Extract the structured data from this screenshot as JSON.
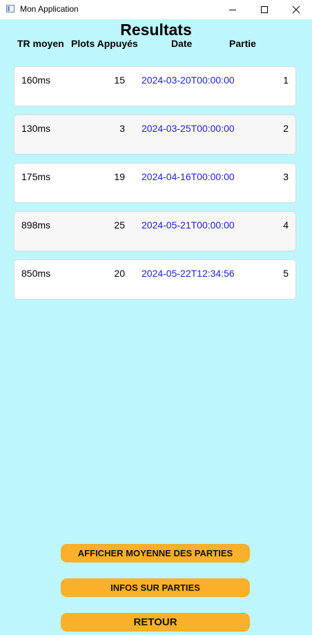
{
  "window": {
    "title": "Mon Application"
  },
  "page": {
    "title": "Resultats"
  },
  "columns": {
    "tr": "TR moyen",
    "plots": "Plots Appuyés",
    "date": "Date",
    "partie": "Partie"
  },
  "rows": [
    {
      "tr": "160ms",
      "plots": "15",
      "date": "2024-03-20T00:00:00",
      "partie": "1"
    },
    {
      "tr": "130ms",
      "plots": "3",
      "date": "2024-03-25T00:00:00",
      "partie": "2"
    },
    {
      "tr": "175ms",
      "plots": "19",
      "date": "2024-04-16T00:00:00",
      "partie": "3"
    },
    {
      "tr": "898ms",
      "plots": "25",
      "date": "2024-05-21T00:00:00",
      "partie": "4"
    },
    {
      "tr": "850ms",
      "plots": "20",
      "date": "2024-05-22T12:34:56",
      "partie": "5"
    }
  ],
  "buttons": {
    "average": "AFFICHER MOYENNE DES PARTIES",
    "info": "INFOS SUR PARTIES",
    "back": "RETOUR"
  },
  "colors": {
    "background": "#bdf7fb",
    "button": "#f9b02b",
    "date_text": "#1f20d6",
    "row_odd": "#ffffff",
    "row_even": "#f7f7f7"
  }
}
